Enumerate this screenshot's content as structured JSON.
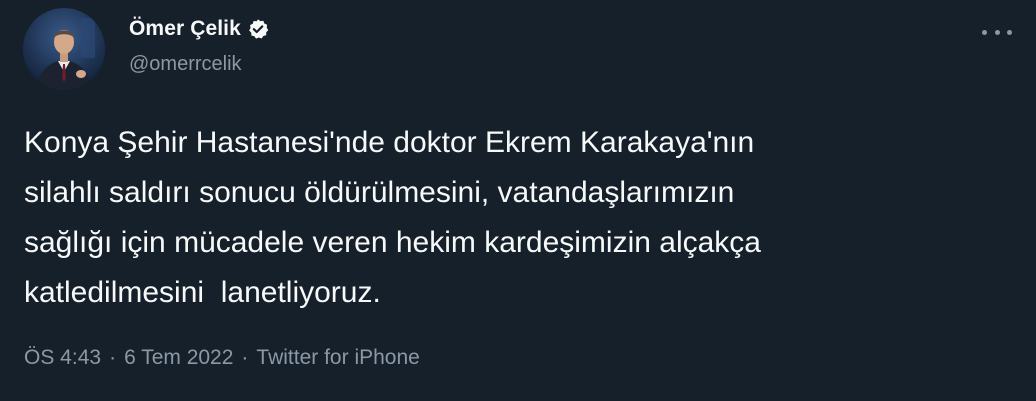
{
  "author": {
    "display_name": "Ömer Çelik",
    "handle": "@omerrcelik",
    "verified": true,
    "avatar_icon": "profile-photo"
  },
  "tweet": {
    "text": "Konya Şehir Hastanesi'nde doktor Ekrem Karakaya'nın\nsilahlı saldırı sonucu öldürülmesini, vatandaşlarımızın\nsağlığı için mücadele veren hekim kardeşimizin alçakça\nkatledilmesini  lanetliyoruz."
  },
  "meta": {
    "time": "ÖS 4:43",
    "separator": "·",
    "date": "6 Tem 2022",
    "source": "Twitter for iPhone"
  },
  "colors": {
    "background": "#15202b",
    "text": "#f7f9f9",
    "secondary": "#8b98a5"
  }
}
